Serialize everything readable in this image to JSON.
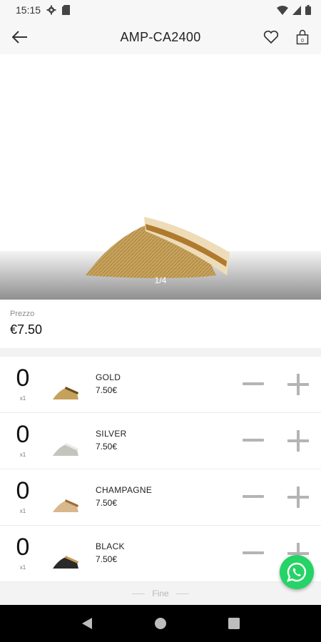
{
  "status_bar": {
    "time": "15:15"
  },
  "header": {
    "title": "AMP-CA2400"
  },
  "gallery": {
    "counter": "1/4"
  },
  "price": {
    "label": "Prezzo",
    "value": "€7.50"
  },
  "variants": [
    {
      "quantity": "0",
      "multiplier": "x1",
      "name": "GOLD",
      "price": "7.50€",
      "color": "#c6a15b"
    },
    {
      "quantity": "0",
      "multiplier": "x1",
      "name": "SILVER",
      "price": "7.50€",
      "color": "#c4c4bd"
    },
    {
      "quantity": "0",
      "multiplier": "x1",
      "name": "CHAMPAGNE",
      "price": "7.50€",
      "color": "#d9b88e"
    },
    {
      "quantity": "0",
      "multiplier": "x1",
      "name": "BLACK",
      "price": "7.50€",
      "color": "#2a2a2a"
    }
  ],
  "footer": {
    "end_label": "Fine"
  },
  "colors": {
    "whatsapp": "#25d366",
    "control_gray": "#b4b4b4"
  }
}
